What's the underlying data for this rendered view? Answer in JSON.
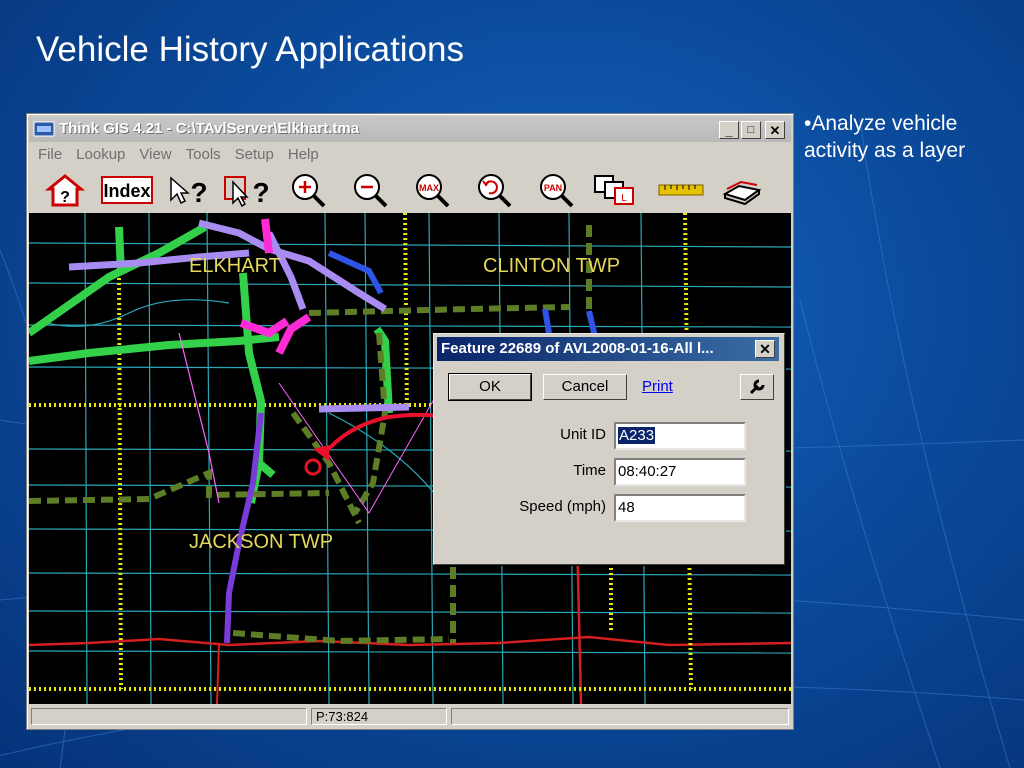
{
  "slide": {
    "title": "Vehicle History Applications",
    "bullets": [
      "Analyze vehicle activity as a layer"
    ]
  },
  "window": {
    "title": "Think GIS 4.21 - C:\\TAvlServer\\Elkhart.tma",
    "controls": {
      "minimize": "_",
      "maximize": "□",
      "close": "✕"
    }
  },
  "menu": [
    "File",
    "Lookup",
    "View",
    "Tools",
    "Setup",
    "Help"
  ],
  "toolbar": {
    "index_label": "Index",
    "icons": [
      "home-help-icon",
      "index-icon",
      "arrow-help-icon",
      "select-help-icon",
      "zoom-in-icon",
      "zoom-out-icon",
      "zoom-max-icon",
      "zoom-previous-icon",
      "pan-icon",
      "layers-icon",
      "ruler-icon",
      "print-icon"
    ],
    "zoom_max_label": "MAX",
    "pan_label": "PAN"
  },
  "map": {
    "labels": [
      "ELKHART",
      "CLINTON TWP",
      "JACKSON TWP"
    ]
  },
  "status": {
    "coords": "P:73:824"
  },
  "dialog": {
    "title": "Feature 22689 of AVL2008-01-16-All l...",
    "ok": "OK",
    "cancel": "Cancel",
    "print": "Print",
    "fields": [
      {
        "label": "Unit ID",
        "value": "A233"
      },
      {
        "label": "Time",
        "value": "08:40:27"
      },
      {
        "label": "Speed (mph)",
        "value": "48"
      }
    ]
  },
  "colors": {
    "slide_bg": "#0b4c9e",
    "title_bar_active": "#0a246a",
    "road_red": "#d42020",
    "gps_green": "#33d14a"
  }
}
